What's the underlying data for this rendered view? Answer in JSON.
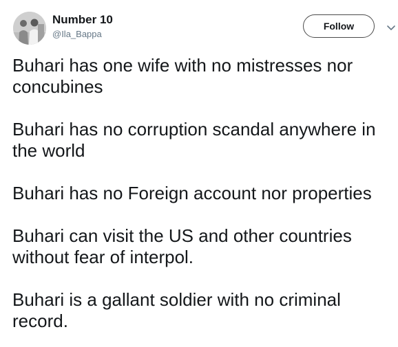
{
  "user": {
    "display_name": "Number 10",
    "handle": "@Ila_Bappa",
    "avatar_icon": "profile-photo"
  },
  "header": {
    "follow_label": "Follow",
    "menu_icon": "chevron-down-icon"
  },
  "tweet": {
    "paragraphs": [
      "Buhari has one wife with no mistresses nor concubines",
      "Buhari has no corruption scandal anywhere in the world",
      "Buhari has no Foreign account nor properties",
      "Buhari can visit the US and other countries without fear of interpol.",
      "Buhari is a gallant soldier with no criminal record."
    ]
  },
  "colors": {
    "text": "#14171a",
    "secondary_text": "#657786",
    "button_border": "#4a4a4a"
  }
}
